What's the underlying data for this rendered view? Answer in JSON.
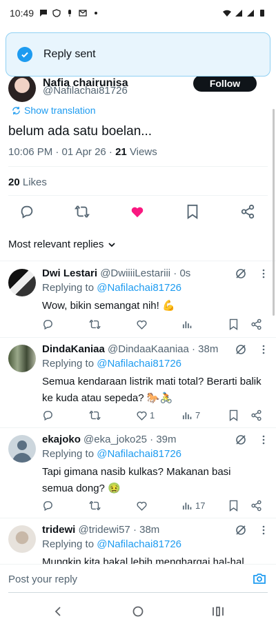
{
  "status_bar": {
    "time": "10:49"
  },
  "toast": {
    "text": "Reply sent"
  },
  "tweet": {
    "author_name": "Nafia chairunisa",
    "author_handle": "@Nafilachai81726",
    "follow_label": "Follow",
    "show_translation": "Show translation",
    "text": "belum ada satu boelan...",
    "timestamp": "10:06 PM · 01 Apr 26 · ",
    "views_count": "21",
    "views_label": " Views",
    "likes_count": "20",
    "likes_label": " Likes"
  },
  "replies_sort": {
    "label": "Most relevant replies"
  },
  "replies": [
    {
      "name": "Dwi Lestari",
      "handle": "@DwiiiiLestariii · 0s",
      "replying_prefix": "Replying to ",
      "replying_to": "@Nafilachai81726",
      "text": "Wow, bikin semangat nih! 💪",
      "likes": "",
      "views": ""
    },
    {
      "name": "DindaKaniaa",
      "handle": "@DindaaKaaniaa · 38m",
      "replying_prefix": "Replying to ",
      "replying_to": "@Nafilachai81726",
      "text": "Semua kendaraan listrik mati total? Berarti balik ke kuda atau sepeda? 🐎🚴",
      "likes": "1",
      "views": "7"
    },
    {
      "name": "ekajoko",
      "handle": "@eka_joko25 · 39m",
      "replying_prefix": "Replying to ",
      "replying_to": "@Nafilachai81726",
      "text": "Tapi gimana nasib kulkas? Makanan basi semua dong? 🤢",
      "likes": "",
      "views": "17"
    },
    {
      "name": "tridewi",
      "handle": "@tridewi57 · 38m",
      "replying_prefix": "Replying to ",
      "replying_to": "@Nafilachai81726",
      "text": "Mungkin kita bakal lebih menghargai hal-hal",
      "likes": "",
      "views": ""
    }
  ],
  "composer": {
    "placeholder": "Post your reply"
  },
  "colors": {
    "accent": "#1d9bf0",
    "like": "#f91880",
    "text_secondary": "#536471"
  },
  "icons": [
    "check-icon",
    "translate-icon",
    "reply-icon",
    "retweet-icon",
    "heart-icon",
    "bookmark-icon",
    "share-icon",
    "chevron-down-icon",
    "grok-icon",
    "more-icon",
    "views-icon",
    "camera-icon",
    "back-icon",
    "home-icon",
    "recents-icon"
  ]
}
